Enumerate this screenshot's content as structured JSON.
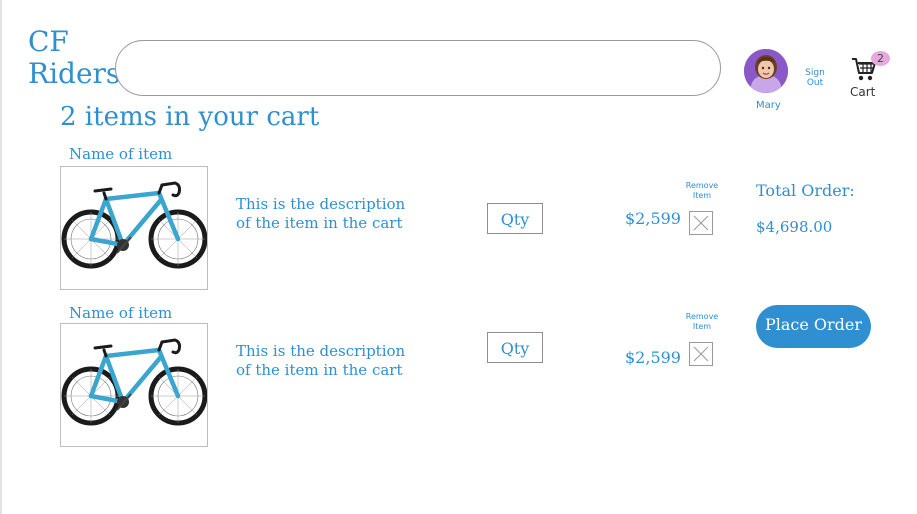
{
  "header": {
    "logo_line1": "CF",
    "logo_line2": "Riders",
    "search_placeholder": "",
    "user_name": "Mary",
    "sign_out_line1": "Sign",
    "sign_out_line2": "Out",
    "cart_label": "Cart",
    "cart_count": "2",
    "avatar_icon": "user-avatar-icon",
    "cart_icon": "shopping-cart-icon"
  },
  "cart": {
    "title": "2 items in your cart",
    "items": [
      {
        "name": "Name of item",
        "description_line1": "This is the description",
        "description_line2": "of the item in the cart",
        "qty_label": "Qty",
        "price": "$2,599",
        "remove_line1": "Remove",
        "remove_line2": "Item",
        "image_icon": "bicycle-image"
      },
      {
        "name": "Name of item",
        "description_line1": "This is the description",
        "description_line2": "of the item in the cart",
        "qty_label": "Qty",
        "price": "$2,599",
        "remove_line1": "Remove",
        "remove_line2": "Item",
        "image_icon": "bicycle-image"
      }
    ]
  },
  "summary": {
    "total_label": "Total Order:",
    "total_value": "$4,698.00",
    "place_order_label": "Place Order"
  },
  "colors": {
    "accent": "#2f8fd0",
    "badge": "#e6a9dc",
    "bike_frame": "#3aa6cf"
  }
}
